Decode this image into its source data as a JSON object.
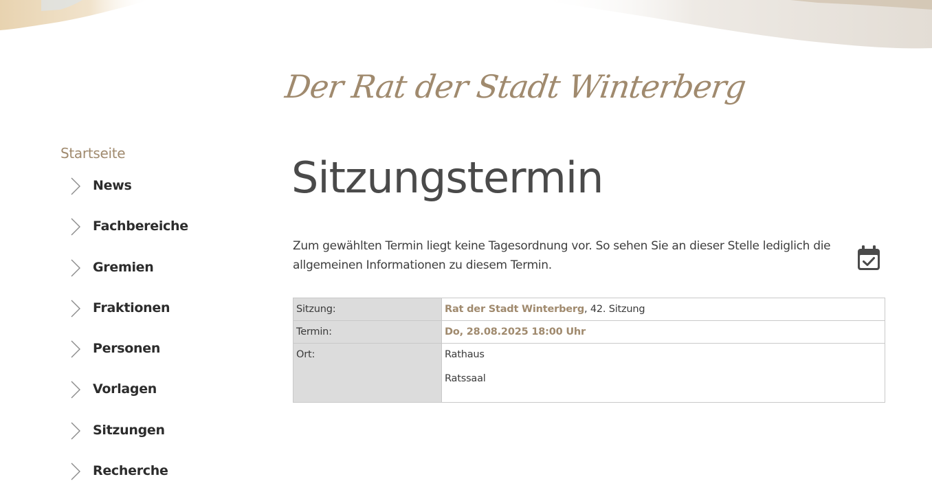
{
  "header": {
    "brand_title": "Der Rat der Stadt Winterberg"
  },
  "sidebar": {
    "home": "Startseite",
    "items": [
      {
        "label": "News",
        "icon": "chevron-right-icon"
      },
      {
        "label": "Fachbereiche",
        "icon": "chevron-right-icon"
      },
      {
        "label": "Gremien",
        "icon": "chevron-right-icon"
      },
      {
        "label": "Fraktionen",
        "icon": "chevron-right-icon"
      },
      {
        "label": "Personen",
        "icon": "chevron-right-icon"
      },
      {
        "label": "Vorlagen",
        "icon": "chevron-right-icon"
      },
      {
        "label": "Sitzungen",
        "icon": "chevron-right-icon"
      },
      {
        "label": "Recherche",
        "icon": "chevron-right-icon"
      }
    ]
  },
  "main": {
    "title": "Sitzungstermin",
    "info": "Zum gewählten Termin liegt keine Tagesordnung vor. So sehen Sie an dieser Stelle lediglich die allgemeinen Informationen zu diesem Termin.",
    "calendar_icon": "calendar-check-icon",
    "details": {
      "sitzung_label": "Sitzung:",
      "sitzung_link": "Rat der Stadt Winterberg",
      "sitzung_suffix": ", 42. Sitzung",
      "termin_label": "Termin:",
      "termin_value": "Do, 28.08.2025 18:00 Uhr",
      "ort_label": "Ort:",
      "ort_line1": "Rathaus",
      "ort_line2": "Ratssaal"
    }
  },
  "colors": {
    "accent": "#a08a6e",
    "text": "#2c2c2c",
    "label_bg": "#dcdcdc",
    "border": "#c9c9c9"
  }
}
